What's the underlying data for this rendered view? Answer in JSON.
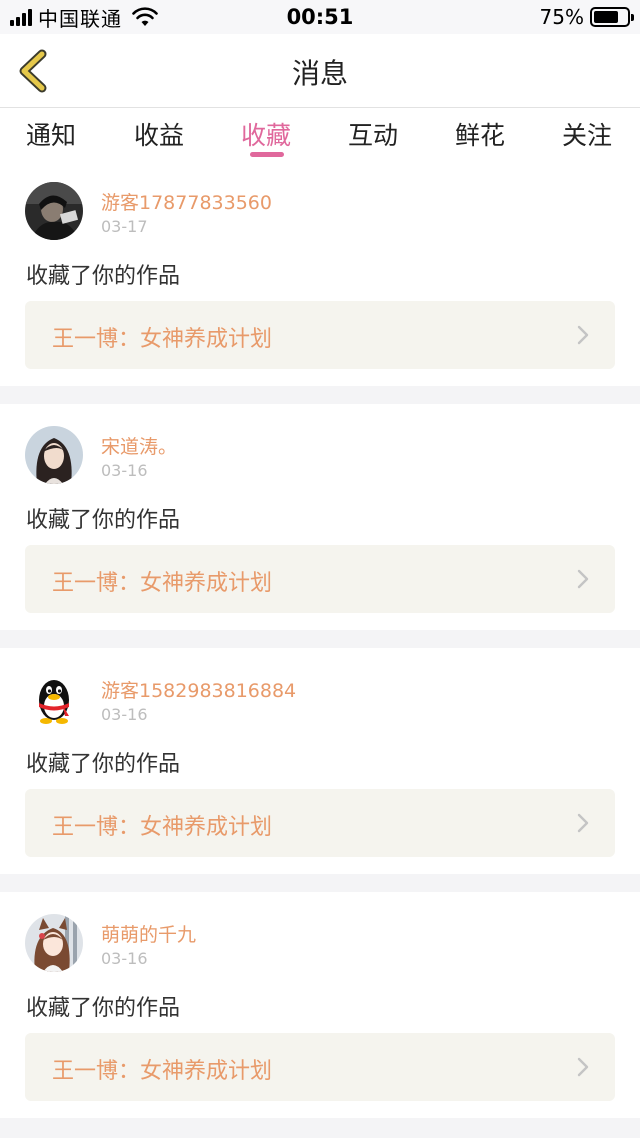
{
  "status_bar": {
    "carrier": "中国联通",
    "time": "00:51",
    "battery_percent": "75%",
    "battery_level": 0.75
  },
  "header": {
    "title": "消息"
  },
  "tabs": [
    {
      "label": "通知",
      "active": false
    },
    {
      "label": "收益",
      "active": false
    },
    {
      "label": "收藏",
      "active": true
    },
    {
      "label": "互动",
      "active": false
    },
    {
      "label": "鲜花",
      "active": false
    },
    {
      "label": "关注",
      "active": false
    }
  ],
  "messages": [
    {
      "user": "游客17877833560",
      "date": "03-17",
      "action": "收藏了你的作品",
      "work": "王一博：女神养成计划",
      "avatar": "dark-photo-avatar"
    },
    {
      "user": "宋道涛。",
      "date": "03-16",
      "action": "收藏了你的作品",
      "work": "王一博：女神养成计划",
      "avatar": "girl-photo-avatar"
    },
    {
      "user": "游客1582983816884",
      "date": "03-16",
      "action": "收藏了你的作品",
      "work": "王一博：女神养成计划",
      "avatar": "penguin-avatar"
    },
    {
      "user": "萌萌的千九",
      "date": "03-16",
      "action": "收藏了你的作品",
      "work": "王一博：女神养成计划",
      "avatar": "anime-girl-avatar"
    }
  ],
  "colors": {
    "accent_pink": "#e0689c",
    "name_orange": "#e89a6a",
    "back_arrow": "#e5c84a",
    "work_bg": "#f5f4ee"
  }
}
